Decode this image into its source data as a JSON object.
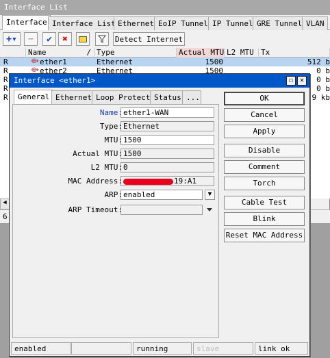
{
  "bg_window": {
    "title": "Interface List",
    "tabs": [
      "Interface",
      "Interface List",
      "Ethernet",
      "EoIP Tunnel",
      "IP Tunnel",
      "GRE Tunnel",
      "VLAN"
    ],
    "toolbar": {
      "detect_label": "Detect Internet"
    },
    "columns": [
      "Name",
      "Type",
      "Actual MTU",
      "L2 MTU",
      "Tx"
    ],
    "rows": [
      {
        "flag": "R",
        "name": "ether1",
        "type": "Ethernet",
        "actual_mtu": "1500",
        "l2_mtu": "",
        "tx": "512 b"
      },
      {
        "flag": "R",
        "name": "ether2",
        "type": "Ethernet",
        "actual_mtu": "1500",
        "l2_mtu": "",
        "tx": "0 b"
      },
      {
        "flag": "R",
        "tx": "0 b"
      },
      {
        "flag": "R",
        "tx": "0 b"
      },
      {
        "flag": "R",
        "tx": "9 kb"
      }
    ],
    "row_count_prefix": "6"
  },
  "dialog": {
    "title": "Interface <ether1>",
    "tabs": [
      "General",
      "Ethernet",
      "Loop Protect",
      "Status",
      "..."
    ],
    "fields": {
      "name": {
        "label": "Name:",
        "value": "ether1-WAN"
      },
      "type": {
        "label": "Type:",
        "value": "Ethernet"
      },
      "mtu": {
        "label": "MTU:",
        "value": "1500"
      },
      "actual_mtu": {
        "label": "Actual MTU:",
        "value": "1500"
      },
      "l2_mtu": {
        "label": "L2 MTU:",
        "value": "0"
      },
      "mac": {
        "label": "MAC Address:",
        "value_suffix": "19:A1"
      },
      "arp": {
        "label": "ARP:",
        "value": "enabled"
      },
      "arp_timeout": {
        "label": "ARP Timeout:",
        "value": ""
      }
    },
    "buttons": [
      "OK",
      "Cancel",
      "Apply",
      "Disable",
      "Comment",
      "Torch",
      "Cable Test",
      "Blink",
      "Reset MAC Address"
    ],
    "status": {
      "state": "enabled",
      "blank": "",
      "running": "running",
      "slave": "slave",
      "link": "link ok"
    }
  },
  "colors": {
    "title_active": "#0058c8",
    "selected_row": "#b8d4f0",
    "redaction": "#e8001c",
    "label_blue": "#1a3cb8"
  }
}
